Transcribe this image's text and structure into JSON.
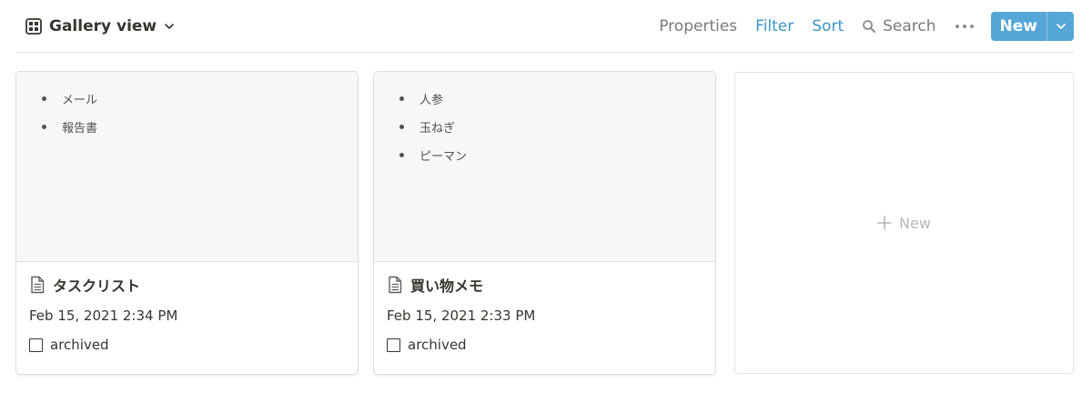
{
  "toolbar": {
    "view_title": "Gallery view",
    "properties_label": "Properties",
    "filter_label": "Filter",
    "sort_label": "Sort",
    "search_label": "Search",
    "new_label": "New"
  },
  "colors": {
    "accent": "#56a6d8",
    "link_blue": "#3a94c9",
    "preview_bg": "#f7f7f6"
  },
  "cards": [
    {
      "preview_items": [
        "メール",
        "報告書"
      ],
      "title": "タスクリスト",
      "date": "Feb 15, 2021 2:34 PM",
      "property_label": "archived",
      "checked": false
    },
    {
      "preview_items": [
        "人参",
        "玉ねぎ",
        "ピーマン"
      ],
      "title": "買い物メモ",
      "date": "Feb 15, 2021 2:33 PM",
      "property_label": "archived",
      "checked": false
    }
  ],
  "new_card": {
    "label": "New"
  },
  "icons": {
    "view": "gallery-grid-icon",
    "chevron": "chevron-down-icon",
    "search": "search-icon",
    "more": "more-dots-icon",
    "page": "page-icon",
    "plus": "plus-icon"
  }
}
